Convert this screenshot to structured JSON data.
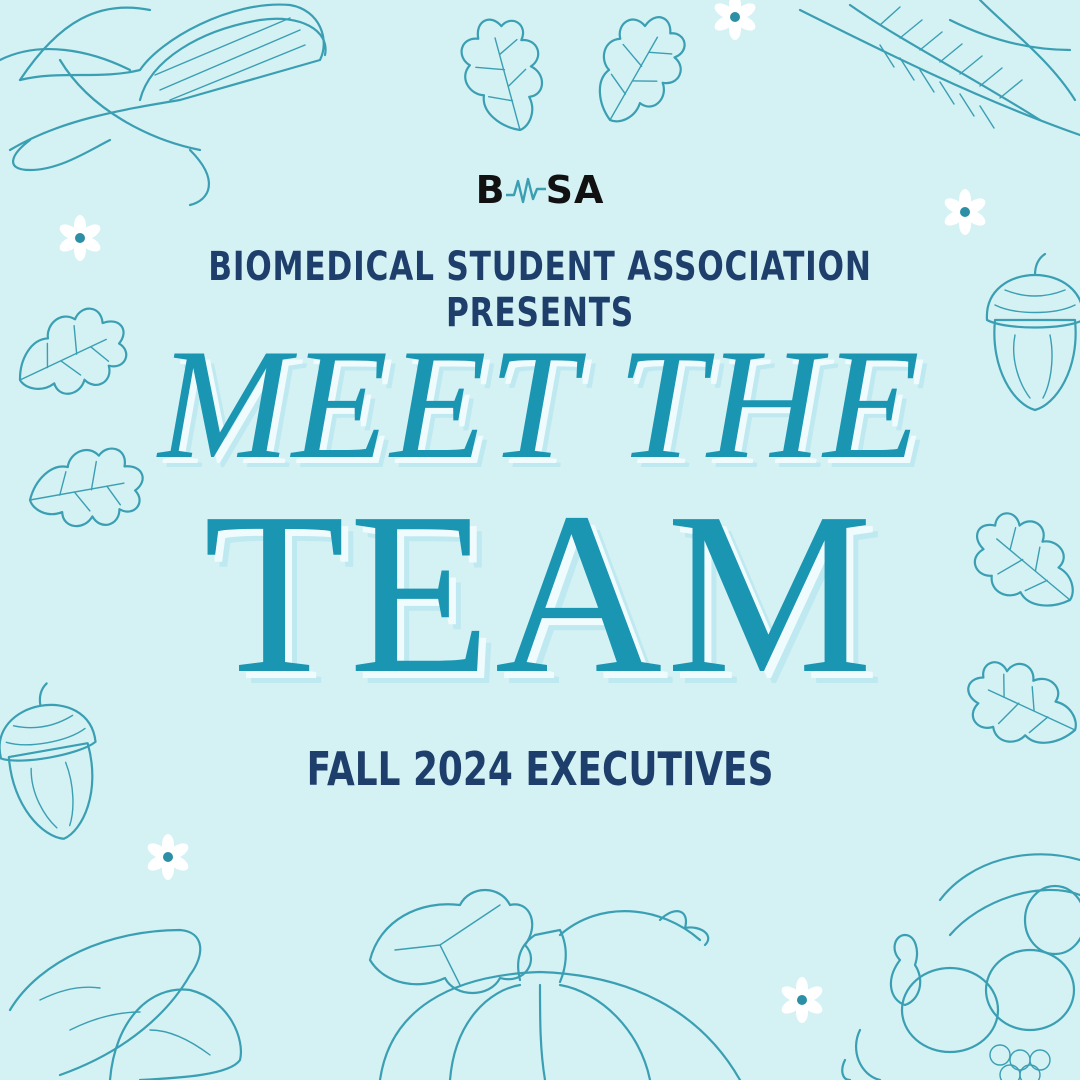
{
  "logo": {
    "text_left": "B",
    "text_right": "SA",
    "mark": "heartbeat-wave"
  },
  "header": {
    "presents": "BIOMEDICAL STUDENT ASSOCIATION PRESENTS"
  },
  "headline": {
    "line1": "MEET THE",
    "line2": "TEAM"
  },
  "subtitle": "FALL 2024 EXECUTIVES",
  "decorations": [
    "corn-icon",
    "oak-leaf-icon",
    "wheat-icon",
    "acorn-icon",
    "daisy-icon",
    "pumpkin-icon",
    "sweet-potato-icon",
    "cornucopia-icon"
  ],
  "colors": {
    "background": "#d4f1f4",
    "accent": "#1a95b2",
    "navy": "#1e3f6b",
    "ink": "#3a9fb3"
  }
}
